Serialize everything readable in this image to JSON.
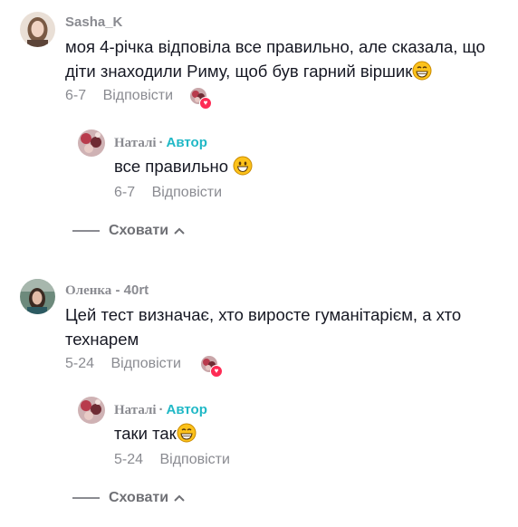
{
  "comments": [
    {
      "username": "Sasha_K",
      "text_line1": "моя 4-річка відповіла все правильно, але сказала, що",
      "text_line2": "діти знаходили Риму, щоб був гарний віршик",
      "date": "6-7",
      "reply_label": "Відповісти",
      "reply": {
        "username": "Наталі",
        "author_label": "Автор",
        "separator": "·",
        "text": "все правильно",
        "date": "6-7",
        "reply_label": "Відповісти"
      },
      "hide_label": "Сховати"
    },
    {
      "username_part1": "Оленка",
      "username_part2": "- 40rt",
      "text_line1": "Цей тест визначає, хто виросте гуманітарієм, а хто",
      "text_line2": "технарем",
      "date": "5-24",
      "reply_label": "Відповісти",
      "reply": {
        "username": "Наталі",
        "author_label": "Автор",
        "separator": "·",
        "text": "таки так",
        "date": "5-24",
        "reply_label": "Відповісти"
      },
      "hide_label": "Сховати"
    }
  ],
  "colors": {
    "author": "#20b8c6",
    "like_heart": "#fe2c55",
    "meta_text": "#8a8b91"
  },
  "icons": [
    "avatar-photo",
    "emoji-grin",
    "emoji-smile",
    "heart-icon",
    "chevron-up-icon"
  ]
}
